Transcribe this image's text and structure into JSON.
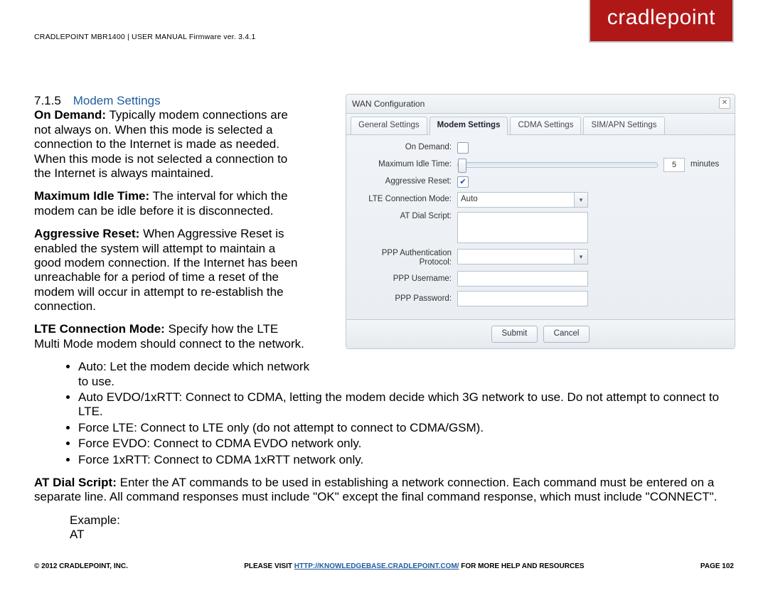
{
  "header": "CRADLEPOINT MBR1400 | USER MANUAL Firmware ver. 3.4.1",
  "logo": "cradlepoint",
  "section": {
    "num": "7.1.5",
    "title": "Modem Settings"
  },
  "paras": {
    "on_demand": "Typically modem connections are not always on. When this mode is selected a connection to the Internet is made as needed. When this mode is not selected a connection to the Internet is always maintained.",
    "max_idle": "The interval for which the modem can be idle before it is disconnected.",
    "agg_reset": "When Aggressive Reset is enabled the system will attempt to maintain a good modem connection. If the Internet has been unreachable for a period of time a reset of the modem will occur in attempt to re-establish the connection.",
    "lte_mode": "Specify how the LTE Multi Mode modem should connect to the network.",
    "at_script": "Enter the AT commands to be used in establishing a network connection. Each command must be entered on a separate line. All command responses must include \"OK\" except the final command response, which must include \"CONNECT\".",
    "example_label": "Example:",
    "example_line": "AT"
  },
  "labels": {
    "on_demand": "On Demand:",
    "max_idle": "Maximum Idle Time:",
    "agg_reset": "Aggressive Reset:",
    "lte_mode": "LTE Connection Mode:",
    "at_script": "AT Dial Script:"
  },
  "bullets": [
    "Auto: Let the modem decide which network to use.",
    "Auto EVDO/1xRTT: Connect to CDMA, letting the modem decide which 3G network to use. Do not attempt to connect to LTE.",
    "Force LTE: Connect to LTE only (do not attempt to connect to CDMA/GSM).",
    "Force EVDO: Connect to CDMA EVDO network only.",
    "Force 1xRTT: Connect to CDMA 1xRTT network only."
  ],
  "dialog": {
    "title": "WAN Configuration",
    "tabs": [
      "General Settings",
      "Modem Settings",
      "CDMA Settings",
      "SIM/APN Settings"
    ],
    "active_tab": 1,
    "fields": {
      "on_demand": "On Demand:",
      "max_idle": "Maximum Idle Time:",
      "agg_reset": "Aggressive Reset:",
      "lte_mode": "LTE Connection Mode:",
      "at_script": "AT Dial Script:",
      "ppp_auth": "PPP Authentication Protocol:",
      "ppp_user": "PPP Username:",
      "ppp_pass": "PPP Password:"
    },
    "values": {
      "on_demand_checked": false,
      "max_idle": "5",
      "max_idle_unit": "minutes",
      "agg_reset_checked": true,
      "lte_mode": "Auto",
      "ppp_auth": "",
      "ppp_user": "",
      "ppp_pass": ""
    },
    "buttons": {
      "submit": "Submit",
      "cancel": "Cancel"
    }
  },
  "footer": {
    "left": "© 2012 CRADLEPOINT, INC.",
    "mid_pre": "PLEASE VISIT ",
    "mid_link": "HTTP://KNOWLEDGEBASE.CRADLEPOINT.COM/",
    "mid_post": " FOR MORE HELP AND RESOURCES",
    "right": "PAGE 102"
  }
}
